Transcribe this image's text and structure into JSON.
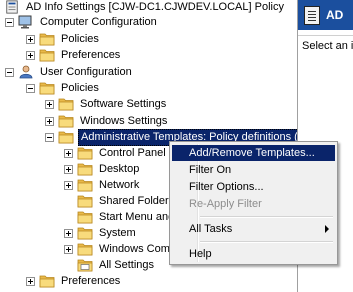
{
  "window": {
    "root_label": "AD Info Settings [CJW-DC1.CJWDEV.LOCAL] Policy"
  },
  "tree": {
    "computer_configuration": "Computer Configuration",
    "cc_policies": "Policies",
    "cc_preferences": "Preferences",
    "user_configuration": "User Configuration",
    "uc_policies": "Policies",
    "software_settings": "Software Settings",
    "windows_settings": "Windows Settings",
    "administrative_templates": "Administrative Templates: Policy definitions (",
    "control_panel": "Control Panel",
    "desktop": "Desktop",
    "network": "Network",
    "shared_folders": "Shared Folders",
    "start_menu": "Start Menu and",
    "system": "System",
    "windows_components": "Windows Comp",
    "all_settings": "All Settings",
    "uc_preferences": "Preferences"
  },
  "right_pane": {
    "header_title": "AD",
    "body_text": "Select an i"
  },
  "context_menu": {
    "add_remove": "Add/Remove Templates...",
    "filter_on": "Filter On",
    "filter_options": "Filter Options...",
    "reapply_filter": "Re-Apply Filter",
    "all_tasks": "All Tasks",
    "help": "Help"
  },
  "colors": {
    "selection": "#0a246a",
    "folder_yellow": "#f6d36a",
    "header_blue": "#1b4f9e"
  }
}
